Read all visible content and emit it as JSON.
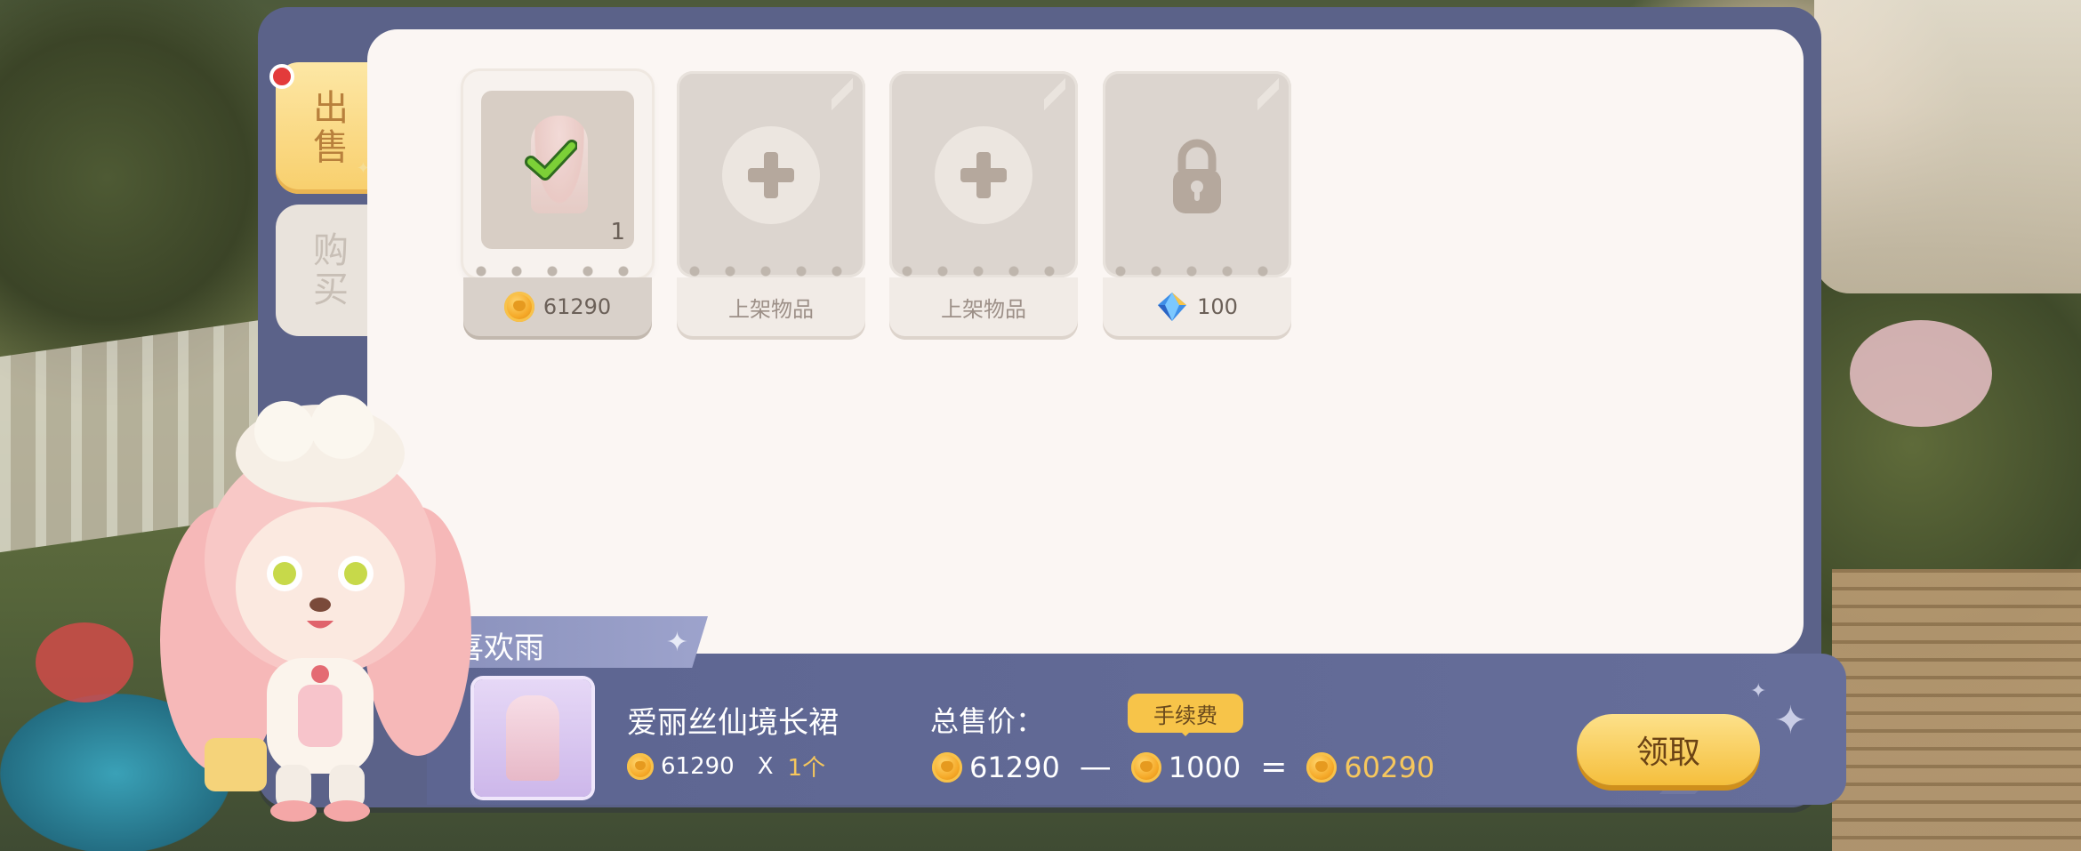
{
  "tabs": [
    {
      "label": "出售",
      "selected": true,
      "has_notification": true
    },
    {
      "label": "购买",
      "selected": false
    }
  ],
  "slots": [
    {
      "state": "listed",
      "item_quantity": "1",
      "price_currency": "coin",
      "price": "61290"
    },
    {
      "state": "empty",
      "label": "上架物品"
    },
    {
      "state": "empty",
      "label": "上架物品"
    },
    {
      "state": "locked",
      "unlock_currency": "diamond",
      "unlock_cost": "100"
    }
  ],
  "player": {
    "name": "喜欢雨"
  },
  "sale": {
    "item_name": "爱丽丝仙境长裙",
    "unit_price": "61290",
    "multiplier": "X",
    "quantity": "1个",
    "total_label": "总售价：",
    "fee_label": "手续费",
    "total": "61290",
    "minus": "—",
    "fee": "1000",
    "equals": "=",
    "net": "60290"
  },
  "claim_button": "领取",
  "colors": {
    "frame": "#5b6289",
    "content": "#fbf6f3",
    "accent_gold": "#f6c75d",
    "button": "#f5bf3d"
  }
}
